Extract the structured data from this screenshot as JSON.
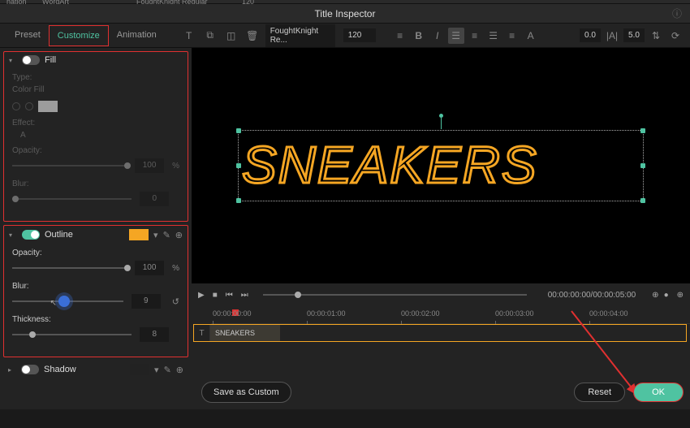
{
  "top_fragment": {
    "a": "nation",
    "b": "WordArt",
    "c": "FoughtKnight Regular",
    "d": "120"
  },
  "header": {
    "title": "Title Inspector"
  },
  "tabs": {
    "preset": "Preset",
    "customize": "Customize",
    "animation": "Animation"
  },
  "toolbar": {
    "font": "FoughtKnight Re...",
    "size": "120",
    "tracking": "0.0",
    "leading": "5.0"
  },
  "panel": {
    "fill": {
      "title": "Fill",
      "type_label": "Type:",
      "type_value": "Color Fill",
      "effect_label": "Effect:",
      "effect_value": "A",
      "opacity_label": "Opacity:",
      "opacity_value": "100",
      "blur_label": "Blur:",
      "blur_value": "0",
      "pct": "%"
    },
    "outline": {
      "title": "Outline",
      "opacity_label": "Opacity:",
      "opacity_value": "100",
      "pct": "%",
      "blur_label": "Blur:",
      "blur_value": "9",
      "thickness_label": "Thickness:",
      "thickness_value": "8"
    },
    "shadow": {
      "title": "Shadow"
    }
  },
  "preview": {
    "text": "SNEAKERS"
  },
  "playback": {
    "timecode": "00:00:00:00/00:00:05:00"
  },
  "timeline": {
    "ticks": [
      "00:00:00:00",
      "00:00:01:00",
      "00:00:02:00",
      "00:00:03:00",
      "00:00:04:00"
    ],
    "clip_label": "SNEAKERS"
  },
  "buttons": {
    "save": "Save as Custom",
    "reset": "Reset",
    "ok": "OK"
  },
  "colors": {
    "accent_orange": "#f5a623",
    "accent_teal": "#4fc3a1",
    "highlight_red": "#e03030"
  }
}
